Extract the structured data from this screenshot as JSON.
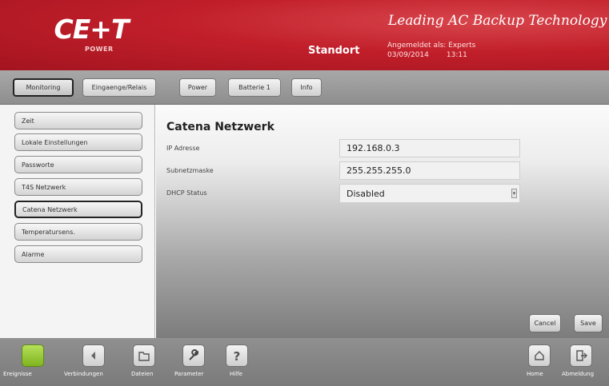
{
  "header": {
    "logo_text": "CE+T",
    "logo_sub": "POWER",
    "tagline": "Leading AC Backup Technology",
    "location": "Standort",
    "login_label": "Angemeldet als: Experts",
    "date": "03/09/2014",
    "time": "13:11"
  },
  "tabs": [
    {
      "label": "Monitoring",
      "active": true
    },
    {
      "label": "Eingaenge/Relais",
      "active": false
    },
    {
      "label": "Power",
      "active": false
    },
    {
      "label": "Batterie 1",
      "active": false
    },
    {
      "label": "Info",
      "active": false
    }
  ],
  "sidebar": {
    "items": [
      {
        "label": "Zeit",
        "active": false
      },
      {
        "label": "Lokale Einstellungen",
        "active": false
      },
      {
        "label": "Passworte",
        "active": false
      },
      {
        "label": "T4S Netzwerk",
        "active": false
      },
      {
        "label": "Catena Netzwerk",
        "active": true
      },
      {
        "label": "Temperatursens.",
        "active": false
      },
      {
        "label": "Alarme",
        "active": false
      }
    ]
  },
  "main": {
    "title": "Catena Netzwerk",
    "fields": [
      {
        "label": "IP Adresse",
        "value": "192.168.0.3"
      },
      {
        "label": "Subnetzmaske",
        "value": "255.255.255.0"
      },
      {
        "label": "DHCP Status",
        "value": "Disabled",
        "type": "select"
      }
    ],
    "cancel_label": "Cancel",
    "save_label": "Save"
  },
  "toolbar": {
    "items": [
      {
        "label": "Ereignisse",
        "icon": "status-light-icon"
      },
      {
        "label": "Verbindungen",
        "icon": "connection-icon"
      },
      {
        "label": "Dateien",
        "icon": "folder-icon"
      },
      {
        "label": "Parameter",
        "icon": "wrench-icon"
      },
      {
        "label": "Hilfe",
        "icon": "question-icon"
      },
      {
        "label": "Home",
        "icon": "home-icon"
      },
      {
        "label": "Abmeldung",
        "icon": "logout-icon"
      }
    ]
  },
  "colors": {
    "header_red": "#c11f2a",
    "status_green": "#9acd32"
  }
}
